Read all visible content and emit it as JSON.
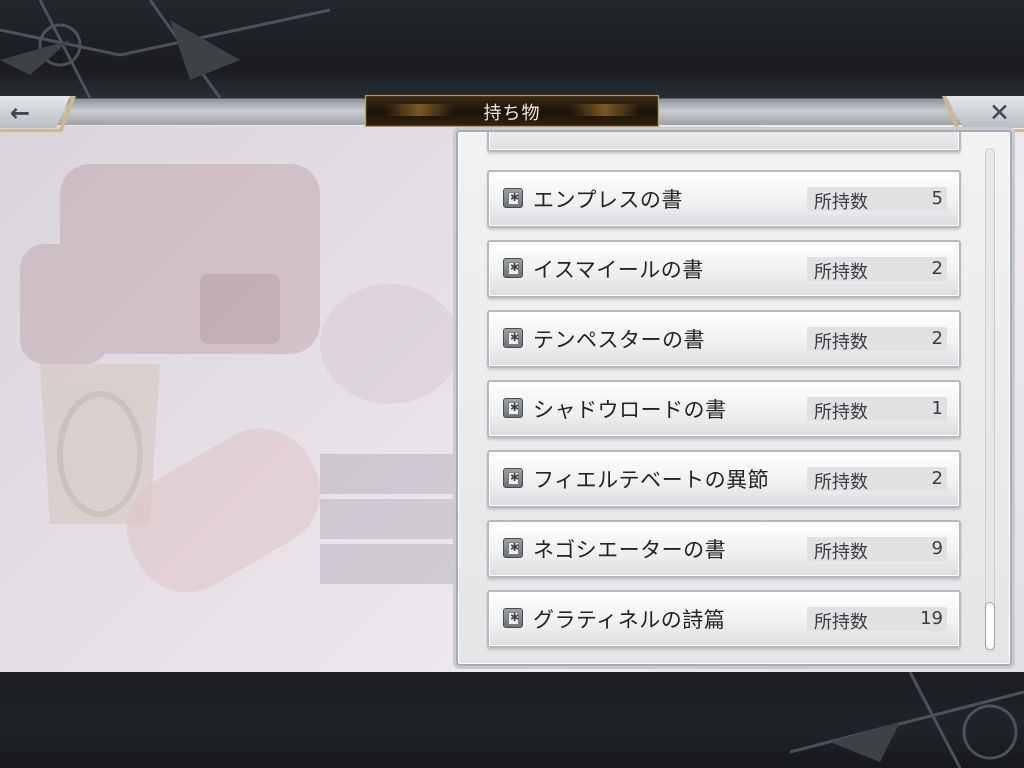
{
  "header": {
    "title": "持ち物",
    "back_icon": "left-arrow-icon",
    "close_icon": "close-x-icon",
    "back_glyph": "←",
    "close_glyph": "✕"
  },
  "inventory": {
    "count_label": "所持数",
    "book_icon": "book-icon",
    "items": [
      {
        "name": "",
        "count": ""
      },
      {
        "name": "エンプレスの書",
        "count": "5"
      },
      {
        "name": "イスマイールの書",
        "count": "2"
      },
      {
        "name": "テンペスターの書",
        "count": "2"
      },
      {
        "name": "シャドウロードの書",
        "count": "1"
      },
      {
        "name": "フィエルテベートの異節",
        "count": "2"
      },
      {
        "name": "ネゴシエーターの書",
        "count": "9"
      },
      {
        "name": "グラティネルの詩篇",
        "count": "19"
      }
    ]
  },
  "colors": {
    "title_plate": "#1a1208",
    "trim_gold": "#cdb88a",
    "content_bg": "#e6e0e7"
  }
}
